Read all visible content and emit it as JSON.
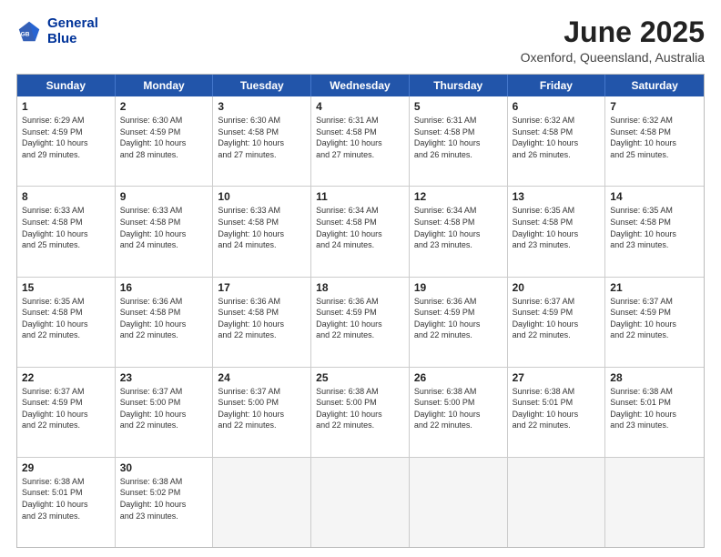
{
  "header": {
    "logo_line1": "General",
    "logo_line2": "Blue",
    "month_title": "June 2025",
    "location": "Oxenford, Queensland, Australia"
  },
  "weekdays": [
    "Sunday",
    "Monday",
    "Tuesday",
    "Wednesday",
    "Thursday",
    "Friday",
    "Saturday"
  ],
  "rows": [
    [
      {
        "day": "1",
        "lines": [
          "Sunrise: 6:29 AM",
          "Sunset: 4:59 PM",
          "Daylight: 10 hours",
          "and 29 minutes."
        ]
      },
      {
        "day": "2",
        "lines": [
          "Sunrise: 6:30 AM",
          "Sunset: 4:59 PM",
          "Daylight: 10 hours",
          "and 28 minutes."
        ]
      },
      {
        "day": "3",
        "lines": [
          "Sunrise: 6:30 AM",
          "Sunset: 4:58 PM",
          "Daylight: 10 hours",
          "and 27 minutes."
        ]
      },
      {
        "day": "4",
        "lines": [
          "Sunrise: 6:31 AM",
          "Sunset: 4:58 PM",
          "Daylight: 10 hours",
          "and 27 minutes."
        ]
      },
      {
        "day": "5",
        "lines": [
          "Sunrise: 6:31 AM",
          "Sunset: 4:58 PM",
          "Daylight: 10 hours",
          "and 26 minutes."
        ]
      },
      {
        "day": "6",
        "lines": [
          "Sunrise: 6:32 AM",
          "Sunset: 4:58 PM",
          "Daylight: 10 hours",
          "and 26 minutes."
        ]
      },
      {
        "day": "7",
        "lines": [
          "Sunrise: 6:32 AM",
          "Sunset: 4:58 PM",
          "Daylight: 10 hours",
          "and 25 minutes."
        ]
      }
    ],
    [
      {
        "day": "8",
        "lines": [
          "Sunrise: 6:33 AM",
          "Sunset: 4:58 PM",
          "Daylight: 10 hours",
          "and 25 minutes."
        ]
      },
      {
        "day": "9",
        "lines": [
          "Sunrise: 6:33 AM",
          "Sunset: 4:58 PM",
          "Daylight: 10 hours",
          "and 24 minutes."
        ]
      },
      {
        "day": "10",
        "lines": [
          "Sunrise: 6:33 AM",
          "Sunset: 4:58 PM",
          "Daylight: 10 hours",
          "and 24 minutes."
        ]
      },
      {
        "day": "11",
        "lines": [
          "Sunrise: 6:34 AM",
          "Sunset: 4:58 PM",
          "Daylight: 10 hours",
          "and 24 minutes."
        ]
      },
      {
        "day": "12",
        "lines": [
          "Sunrise: 6:34 AM",
          "Sunset: 4:58 PM",
          "Daylight: 10 hours",
          "and 23 minutes."
        ]
      },
      {
        "day": "13",
        "lines": [
          "Sunrise: 6:35 AM",
          "Sunset: 4:58 PM",
          "Daylight: 10 hours",
          "and 23 minutes."
        ]
      },
      {
        "day": "14",
        "lines": [
          "Sunrise: 6:35 AM",
          "Sunset: 4:58 PM",
          "Daylight: 10 hours",
          "and 23 minutes."
        ]
      }
    ],
    [
      {
        "day": "15",
        "lines": [
          "Sunrise: 6:35 AM",
          "Sunset: 4:58 PM",
          "Daylight: 10 hours",
          "and 22 minutes."
        ]
      },
      {
        "day": "16",
        "lines": [
          "Sunrise: 6:36 AM",
          "Sunset: 4:58 PM",
          "Daylight: 10 hours",
          "and 22 minutes."
        ]
      },
      {
        "day": "17",
        "lines": [
          "Sunrise: 6:36 AM",
          "Sunset: 4:58 PM",
          "Daylight: 10 hours",
          "and 22 minutes."
        ]
      },
      {
        "day": "18",
        "lines": [
          "Sunrise: 6:36 AM",
          "Sunset: 4:59 PM",
          "Daylight: 10 hours",
          "and 22 minutes."
        ]
      },
      {
        "day": "19",
        "lines": [
          "Sunrise: 6:36 AM",
          "Sunset: 4:59 PM",
          "Daylight: 10 hours",
          "and 22 minutes."
        ]
      },
      {
        "day": "20",
        "lines": [
          "Sunrise: 6:37 AM",
          "Sunset: 4:59 PM",
          "Daylight: 10 hours",
          "and 22 minutes."
        ]
      },
      {
        "day": "21",
        "lines": [
          "Sunrise: 6:37 AM",
          "Sunset: 4:59 PM",
          "Daylight: 10 hours",
          "and 22 minutes."
        ]
      }
    ],
    [
      {
        "day": "22",
        "lines": [
          "Sunrise: 6:37 AM",
          "Sunset: 4:59 PM",
          "Daylight: 10 hours",
          "and 22 minutes."
        ]
      },
      {
        "day": "23",
        "lines": [
          "Sunrise: 6:37 AM",
          "Sunset: 5:00 PM",
          "Daylight: 10 hours",
          "and 22 minutes."
        ]
      },
      {
        "day": "24",
        "lines": [
          "Sunrise: 6:37 AM",
          "Sunset: 5:00 PM",
          "Daylight: 10 hours",
          "and 22 minutes."
        ]
      },
      {
        "day": "25",
        "lines": [
          "Sunrise: 6:38 AM",
          "Sunset: 5:00 PM",
          "Daylight: 10 hours",
          "and 22 minutes."
        ]
      },
      {
        "day": "26",
        "lines": [
          "Sunrise: 6:38 AM",
          "Sunset: 5:00 PM",
          "Daylight: 10 hours",
          "and 22 minutes."
        ]
      },
      {
        "day": "27",
        "lines": [
          "Sunrise: 6:38 AM",
          "Sunset: 5:01 PM",
          "Daylight: 10 hours",
          "and 22 minutes."
        ]
      },
      {
        "day": "28",
        "lines": [
          "Sunrise: 6:38 AM",
          "Sunset: 5:01 PM",
          "Daylight: 10 hours",
          "and 23 minutes."
        ]
      }
    ],
    [
      {
        "day": "29",
        "lines": [
          "Sunrise: 6:38 AM",
          "Sunset: 5:01 PM",
          "Daylight: 10 hours",
          "and 23 minutes."
        ]
      },
      {
        "day": "30",
        "lines": [
          "Sunrise: 6:38 AM",
          "Sunset: 5:02 PM",
          "Daylight: 10 hours",
          "and 23 minutes."
        ]
      },
      {
        "day": "",
        "lines": []
      },
      {
        "day": "",
        "lines": []
      },
      {
        "day": "",
        "lines": []
      },
      {
        "day": "",
        "lines": []
      },
      {
        "day": "",
        "lines": []
      }
    ]
  ]
}
